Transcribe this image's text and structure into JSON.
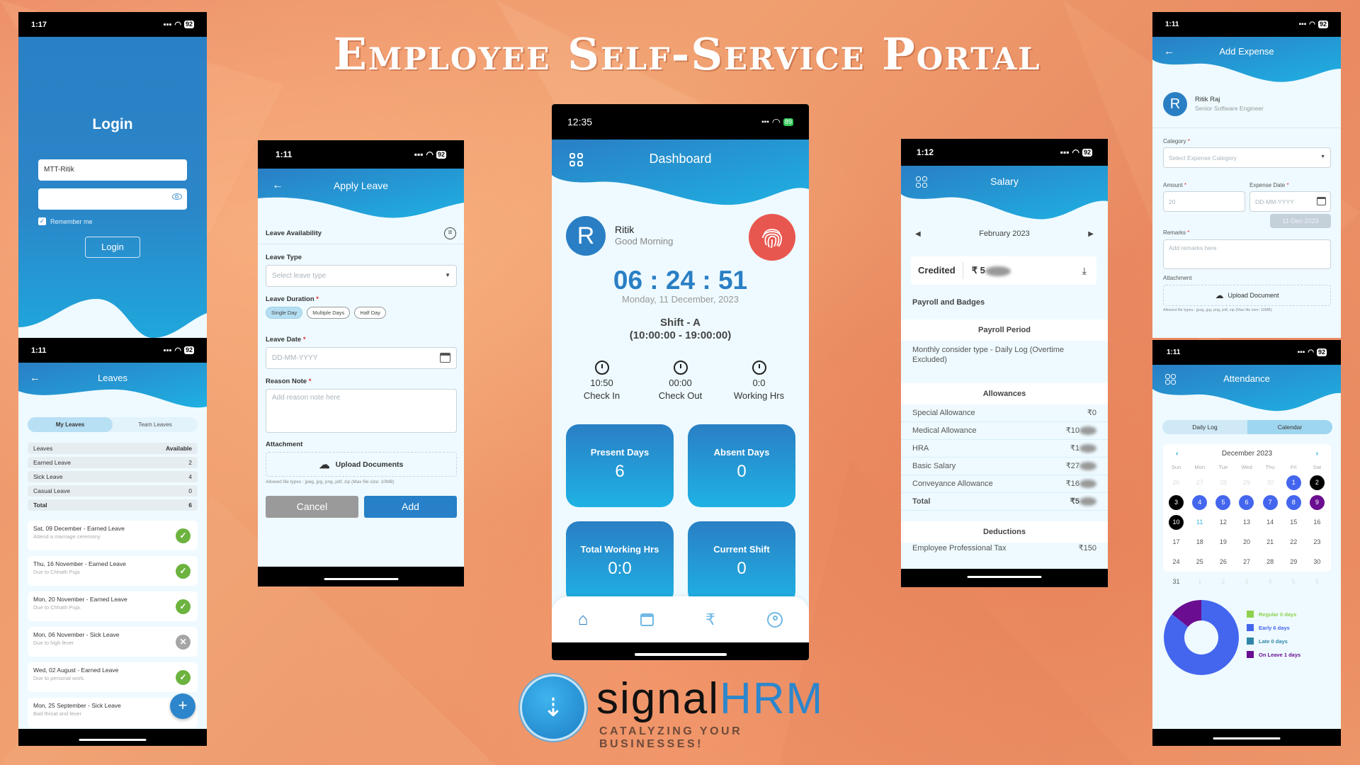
{
  "page": {
    "title": "Employee Self-Service Portal",
    "brand": {
      "name_part1": "signal",
      "name_part2": "HRM",
      "tagline": "CATALYZING YOUR BUSINESSES!"
    },
    "colors": {
      "primary": "#2a7fc4",
      "accent_light": "#1fb0e2",
      "background": "#ee9a6e",
      "approved": "#6db33f",
      "rejected": "#a5a5a5",
      "punch": "#e8524a"
    }
  },
  "login": {
    "status_time": "1:17",
    "battery": "92",
    "title": "Login",
    "username_value": "MTT-Ritik",
    "password_value": "",
    "remember_label": "Remember me",
    "remember_checked": true,
    "login_button": "Login"
  },
  "leaves": {
    "status_time": "1:11",
    "battery": "92",
    "title": "Leaves",
    "tabs": [
      {
        "label": "My Leaves",
        "active": true
      },
      {
        "label": "Team Leaves",
        "active": false
      }
    ],
    "table_header": {
      "name": "Leaves",
      "value": "Available"
    },
    "rows": [
      {
        "name": "Earned Leave",
        "value": "2"
      },
      {
        "name": "Sick Leave",
        "value": "4"
      },
      {
        "name": "Casual Leave",
        "value": "0"
      }
    ],
    "total": {
      "name": "Total",
      "value": "6"
    },
    "items": [
      {
        "title": "Sat, 09 December - Earned Leave",
        "reason": "Attend a marriage ceremony",
        "status": "approved"
      },
      {
        "title": "Thu, 16 November - Earned Leave",
        "reason": "Due to Chhath Puja",
        "status": "approved"
      },
      {
        "title": "Mon, 20 November - Earned Leave",
        "reason": "Due to Chhath Puja.",
        "status": "approved"
      },
      {
        "title": "Mon, 06 November - Sick Leave",
        "reason": "Due to high fever",
        "status": "rejected"
      },
      {
        "title": "Wed, 02 August - Earned Leave",
        "reason": "Due to personal work.",
        "status": "approved"
      },
      {
        "title": "Mon, 25 September - Sick Leave",
        "reason": "Bad throat and fever",
        "status": "none"
      }
    ],
    "fab_label": "+"
  },
  "apply_leave": {
    "status_time": "1:11",
    "battery": "92",
    "title": "Apply Leave",
    "availability_label": "Leave Availability",
    "leave_type_label": "Leave Type",
    "leave_type_placeholder": "Select leave type",
    "duration_label": "Leave Duration",
    "duration_options": [
      {
        "label": "Single Day",
        "selected": true
      },
      {
        "label": "Multiple Days",
        "selected": false
      },
      {
        "label": "Half Day",
        "selected": false
      }
    ],
    "date_label": "Leave Date",
    "date_placeholder": "DD-MM-YYYY",
    "reason_label": "Reason Note",
    "reason_placeholder": "Add reason note here",
    "attachment_label": "Attachment",
    "upload_label": "Upload Documents",
    "allowed_types": "Allowed file types : jpeg, jpg, png, pdf, zip (Max file size: 10MB)",
    "cancel_button": "Cancel",
    "add_button": "Add",
    "required_mark": "*"
  },
  "dashboard": {
    "status_time": "12:35",
    "battery": "89",
    "title": "Dashboard",
    "avatar_letter": "R",
    "user_name": "Ritik",
    "greeting": "Good Morning",
    "clock": "06 : 24 : 51",
    "date": "Monday, 11 December, 2023",
    "shift_name": "Shift - A",
    "shift_time": "(10:00:00 - 19:00:00)",
    "stats": [
      {
        "value": "10:50",
        "label": "Check In",
        "icon": "clock-in-icon"
      },
      {
        "value": "00:00",
        "label": "Check Out",
        "icon": "clock-out-icon"
      },
      {
        "value": "0:0",
        "label": "Working Hrs",
        "icon": "clock-check-icon"
      }
    ],
    "cards": [
      {
        "label": "Present Days",
        "value": "6"
      },
      {
        "label": "Absent Days",
        "value": "0"
      },
      {
        "label": "Total Working Hrs",
        "value": "0:0"
      },
      {
        "label": "Current Shift",
        "value": "0"
      }
    ],
    "nav": [
      {
        "name": "home",
        "active": true
      },
      {
        "name": "calendar",
        "active": false
      },
      {
        "name": "salary",
        "active": false
      },
      {
        "name": "profile",
        "active": false
      }
    ]
  },
  "salary": {
    "status_time": "1:12",
    "battery": "92",
    "title": "Salary",
    "month": "February 2023",
    "credited_label": "Credited",
    "credited_value": "₹ 5",
    "payroll_heading": "Payroll and Badges",
    "period_heading": "Payroll Period",
    "period_text": "Monthly consider type - Daily Log (Overtime Excluded)",
    "allowances_heading": "Allowances",
    "allowances": [
      {
        "name": "Special Allowance",
        "value": "₹0",
        "blurred": false
      },
      {
        "name": "Medical Allowance",
        "value": "₹10",
        "blurred": true
      },
      {
        "name": "HRA",
        "value": "₹1",
        "blurred": true
      },
      {
        "name": "Basic Salary",
        "value": "₹27",
        "blurred": true
      },
      {
        "name": "Conveyance Allowance",
        "value": "₹16",
        "blurred": true
      }
    ],
    "total": {
      "name": "Total",
      "value": "₹5",
      "blurred": true
    },
    "deductions_heading": "Deductions",
    "deductions": [
      {
        "name": "Employee Professional Tax",
        "value": "₹150"
      }
    ]
  },
  "expense": {
    "status_time": "1:11",
    "battery": "92",
    "title": "Add Expense",
    "avatar_letter": "R",
    "user_name": "Ritik Raj",
    "designation": "Senior Software Engineer",
    "category_label": "Category",
    "category_placeholder": "Select Expense Category",
    "amount_label": "Amount",
    "amount_placeholder": "20",
    "date_label": "Expense Date",
    "date_placeholder": "DD-MM-YYYY",
    "date_tooltip": "11-Dec-2023",
    "remarks_label": "Remarks",
    "remarks_placeholder": "Add remarks here",
    "attachment_label": "Attachment",
    "upload_label": "Upload Document",
    "allowed_types": "Allowed file types : jpeg, jpg, png, pdf, zip (Max file size: 10MB)",
    "required_mark": "*"
  },
  "attendance": {
    "status_time": "1:11",
    "battery": "92",
    "title": "Attendance",
    "tabs": [
      {
        "label": "Daily Log",
        "active": false
      },
      {
        "label": "Calendar",
        "active": true
      }
    ],
    "month": "December 2023",
    "weekdays": [
      "Sun",
      "Mon",
      "Tue",
      "Wed",
      "Thu",
      "Fri",
      "Sat"
    ],
    "days": [
      {
        "d": "26",
        "t": "other"
      },
      {
        "d": "27",
        "t": "other"
      },
      {
        "d": "28",
        "t": "other"
      },
      {
        "d": "29",
        "t": "other"
      },
      {
        "d": "30",
        "t": "other"
      },
      {
        "d": "1",
        "t": "early"
      },
      {
        "d": "2",
        "t": "off"
      },
      {
        "d": "3",
        "t": "off"
      },
      {
        "d": "4",
        "t": "early"
      },
      {
        "d": "5",
        "t": "early"
      },
      {
        "d": "6",
        "t": "early"
      },
      {
        "d": "7",
        "t": "early"
      },
      {
        "d": "8",
        "t": "early"
      },
      {
        "d": "9",
        "t": "leave"
      },
      {
        "d": "10",
        "t": "off"
      },
      {
        "d": "11",
        "t": "today"
      },
      {
        "d": "12",
        "t": "n"
      },
      {
        "d": "13",
        "t": "n"
      },
      {
        "d": "14",
        "t": "n"
      },
      {
        "d": "15",
        "t": "n"
      },
      {
        "d": "16",
        "t": "n"
      },
      {
        "d": "17",
        "t": "n"
      },
      {
        "d": "18",
        "t": "n"
      },
      {
        "d": "19",
        "t": "n"
      },
      {
        "d": "20",
        "t": "n"
      },
      {
        "d": "21",
        "t": "n"
      },
      {
        "d": "22",
        "t": "n"
      },
      {
        "d": "23",
        "t": "n"
      },
      {
        "d": "24",
        "t": "n"
      },
      {
        "d": "25",
        "t": "n"
      },
      {
        "d": "26",
        "t": "n"
      },
      {
        "d": "27",
        "t": "n"
      },
      {
        "d": "28",
        "t": "n"
      },
      {
        "d": "29",
        "t": "n"
      },
      {
        "d": "30",
        "t": "n"
      },
      {
        "d": "31",
        "t": "n"
      },
      {
        "d": "1",
        "t": "other"
      },
      {
        "d": "2",
        "t": "other"
      },
      {
        "d": "3",
        "t": "other"
      },
      {
        "d": "4",
        "t": "other"
      },
      {
        "d": "5",
        "t": "other"
      },
      {
        "d": "6",
        "t": "other"
      }
    ],
    "chart_data": {
      "type": "pie",
      "donut": true,
      "categories": [
        "Regular",
        "Early",
        "Late",
        "On Leave"
      ],
      "values": [
        0,
        6,
        0,
        1
      ],
      "colors": [
        "#8fd14f",
        "#4466ee",
        "#2f86a8",
        "#6a0d91"
      ],
      "legend": [
        "Regular 0 days",
        "Early 6 days",
        "Late 0 days",
        "On Leave 1 days"
      ],
      "legend_position": "right"
    }
  }
}
